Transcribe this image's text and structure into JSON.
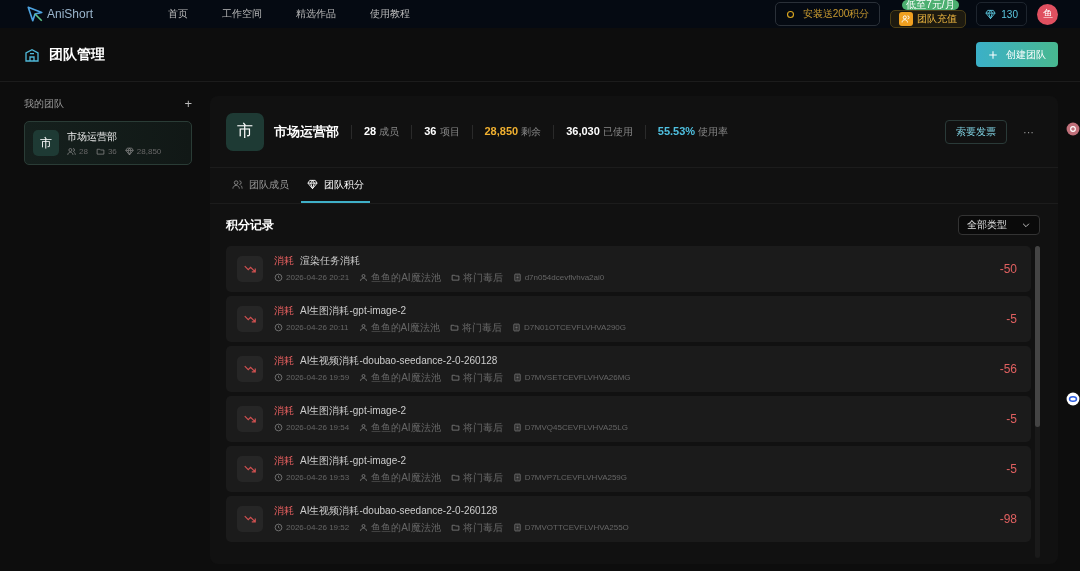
{
  "nav": {
    "logo": "AniShort",
    "links": [
      {
        "label": "首页"
      },
      {
        "label": "工作空间"
      },
      {
        "label": "精选作品"
      },
      {
        "label": "使用教程"
      }
    ],
    "promo": "安装送200积分",
    "recharge": {
      "label": "团队充值",
      "badge": "低至7元/月"
    },
    "credits": "130",
    "avatar": "鱼"
  },
  "page": {
    "title": "团队管理",
    "create_button": "创建团队"
  },
  "sidebar": {
    "title": "我的团队",
    "add": "+",
    "teams": [
      {
        "avatar": "市",
        "name": "市场运营部",
        "members": "28",
        "projects": "36",
        "credits": "28,850",
        "selected": true
      }
    ]
  },
  "team": {
    "avatar": "市",
    "name": "市场运营部",
    "stats": [
      {
        "value": "28",
        "label": "成员",
        "kind": "plain"
      },
      {
        "value": "36",
        "label": "项目",
        "kind": "plain"
      },
      {
        "value": "28,850",
        "label": "剩余",
        "kind": "remaining"
      },
      {
        "value": "36,030",
        "label": "已使用",
        "kind": "plain"
      },
      {
        "value": "55.53%",
        "label": "使用率",
        "kind": "rate"
      }
    ],
    "invoice_button": "索要发票",
    "more": "···",
    "tabs": [
      {
        "label": "团队成员",
        "kind": "members",
        "selected": false
      },
      {
        "label": "团队积分",
        "kind": "credits",
        "selected": true
      }
    ]
  },
  "records": {
    "title": "积分记录",
    "filter": "全部类型",
    "items": [
      {
        "type": "消耗",
        "description": "渲染任务消耗",
        "time": "2026-04-26 20:21",
        "user": "鱼鱼的AI魔法池",
        "project": "将门毒后",
        "id": "d7n054dcevflvhva2ai0",
        "amount": "-50"
      },
      {
        "type": "消耗",
        "description": "AI生图消耗-gpt-image-2",
        "time": "2026-04-26 20:11",
        "user": "鱼鱼的AI魔法池",
        "project": "将门毒后",
        "id": "D7N01OTCEVFLVHVA290G",
        "amount": "-5"
      },
      {
        "type": "消耗",
        "description": "AI生视频消耗-doubao-seedance-2-0-260128",
        "time": "2026-04-26 19:59",
        "user": "鱼鱼的AI魔法池",
        "project": "将门毒后",
        "id": "D7MVSETCEVFLVHVA26MG",
        "amount": "-56"
      },
      {
        "type": "消耗",
        "description": "AI生图消耗-gpt-image-2",
        "time": "2026-04-26 19:54",
        "user": "鱼鱼的AI魔法池",
        "project": "将门毒后",
        "id": "D7MVQ45CEVFLVHVA25LG",
        "amount": "-5"
      },
      {
        "type": "消耗",
        "description": "AI生图消耗-gpt-image-2",
        "time": "2026-04-26 19:53",
        "user": "鱼鱼的AI魔法池",
        "project": "将门毒后",
        "id": "D7MVP7LCEVFLVHVA259G",
        "amount": "-5"
      },
      {
        "type": "消耗",
        "description": "AI生视频消耗-doubao-seedance-2-0-260128",
        "time": "2026-04-26 19:52",
        "user": "鱼鱼的AI魔法池",
        "project": "将门毒后",
        "id": "D7MVOTTCEVFLVHVA255O",
        "amount": "-98"
      }
    ]
  }
}
